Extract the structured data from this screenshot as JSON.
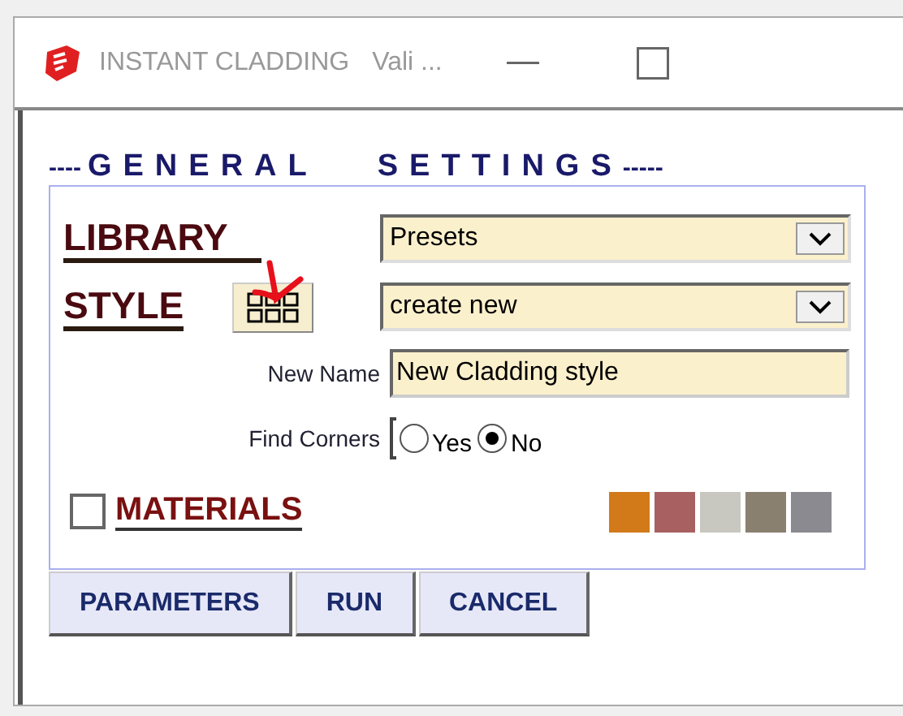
{
  "window": {
    "title": "INSTANT CLADDING",
    "subtitle": "Vali ..."
  },
  "heading": {
    "lead": "----",
    "title": "GENERAL   SETTINGS",
    "trail": "-----"
  },
  "library": {
    "label": "LIBRARY",
    "value": "Presets"
  },
  "style": {
    "label": "STYLE",
    "value": "create new"
  },
  "new_name": {
    "label": "New Name",
    "value": "New Cladding style"
  },
  "find_corners": {
    "label": "Find Corners",
    "options": [
      {
        "label": "Yes",
        "selected": false
      },
      {
        "label": "No",
        "selected": true
      }
    ]
  },
  "materials": {
    "label": "MATERIALS",
    "checked": false,
    "swatches": [
      {
        "color": "#d27a1a"
      },
      {
        "color": "#a86060"
      },
      {
        "color": "#c8c8c0"
      },
      {
        "color": "#8a8070"
      },
      {
        "color": "#8a8a90"
      }
    ]
  },
  "buttons": [
    "PARAMETERS",
    "RUN",
    "CANCEL"
  ]
}
